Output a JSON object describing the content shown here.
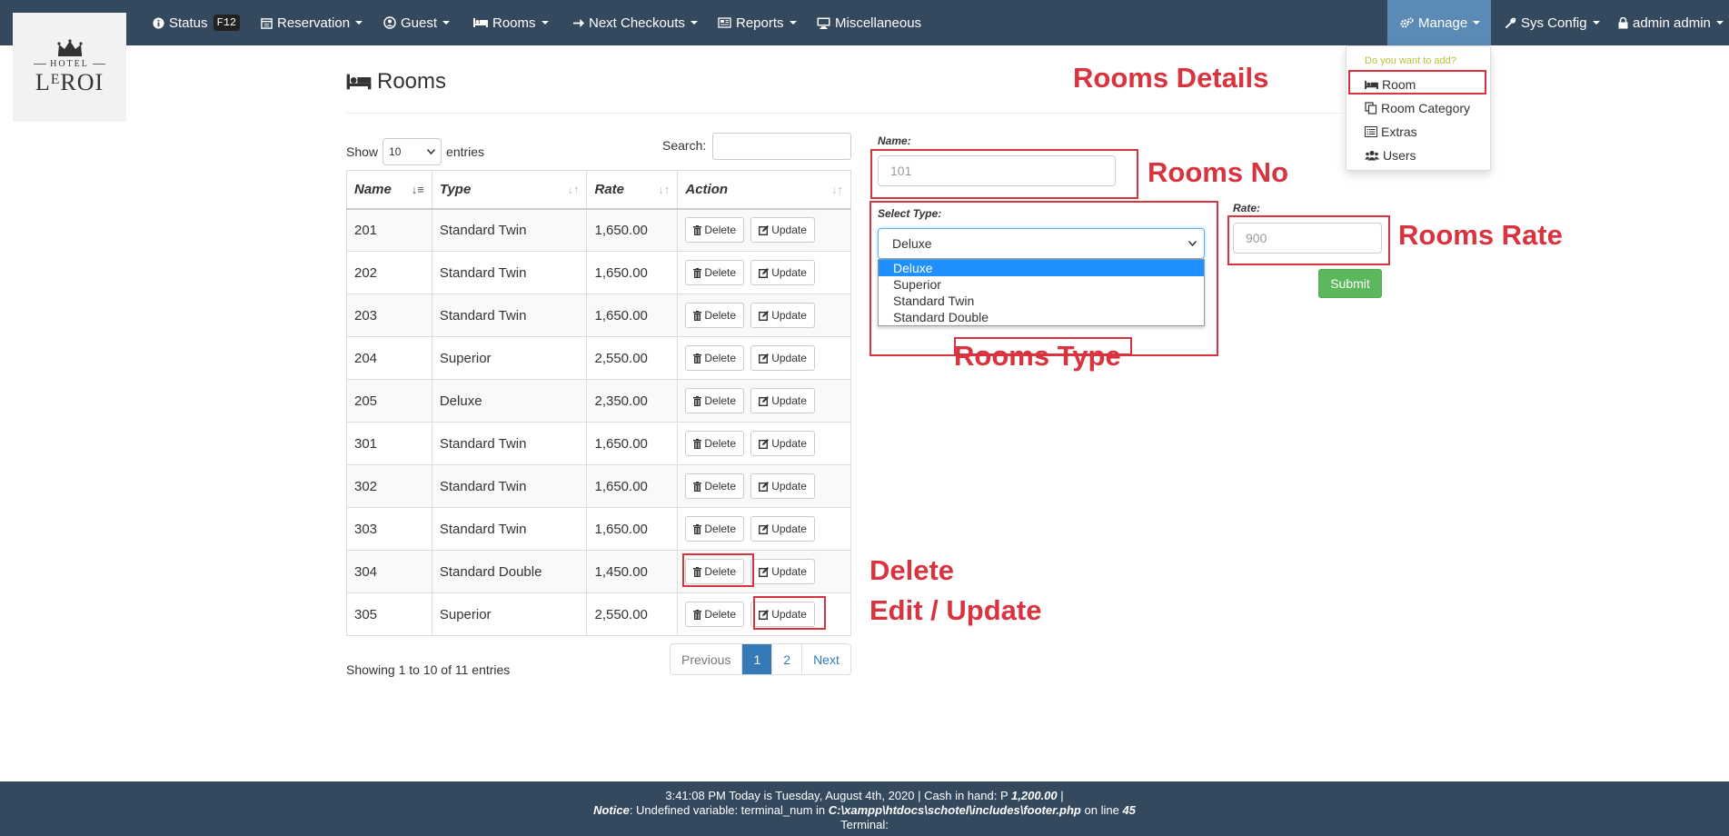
{
  "logo": {
    "top": "HOTEL",
    "name": "LᴱROI"
  },
  "navbar": {
    "status": "Status",
    "status_key": "F12",
    "reservation": "Reservation",
    "guest": "Guest",
    "rooms": "Rooms",
    "next_checkouts": "Next Checkouts",
    "reports": "Reports",
    "misc": "Miscellaneous",
    "manage": "Manage",
    "sys_config": "Sys Config",
    "user": "admin admin"
  },
  "manage_menu": {
    "header": "Do you want to add?",
    "items": [
      "Room",
      "Room Category",
      "Extras",
      "Users"
    ]
  },
  "page": {
    "title": "Rooms"
  },
  "table_controls": {
    "show_label": "Show",
    "show_value": "10",
    "entries_label": "entries",
    "search_label": "Search:"
  },
  "table": {
    "headers": [
      "Name",
      "Type",
      "Rate",
      "Action"
    ],
    "delete_label": "Delete",
    "update_label": "Update",
    "rows": [
      {
        "name": "201",
        "type": "Standard Twin",
        "rate": "1,650.00"
      },
      {
        "name": "202",
        "type": "Standard Twin",
        "rate": "1,650.00"
      },
      {
        "name": "203",
        "type": "Standard Twin",
        "rate": "1,650.00"
      },
      {
        "name": "204",
        "type": "Superior",
        "rate": "2,550.00"
      },
      {
        "name": "205",
        "type": "Deluxe",
        "rate": "2,350.00"
      },
      {
        "name": "301",
        "type": "Standard Twin",
        "rate": "1,650.00"
      },
      {
        "name": "302",
        "type": "Standard Twin",
        "rate": "1,650.00"
      },
      {
        "name": "303",
        "type": "Standard Twin",
        "rate": "1,650.00"
      },
      {
        "name": "304",
        "type": "Standard Double",
        "rate": "1,450.00"
      },
      {
        "name": "305",
        "type": "Superior",
        "rate": "2,550.00"
      }
    ],
    "info": "Showing 1 to 10 of 11 entries",
    "pager": {
      "previous": "Previous",
      "page1": "1",
      "page2": "2",
      "next": "Next"
    }
  },
  "form": {
    "name_label": "Name:",
    "name_placeholder": "101",
    "type_label": "Select Type:",
    "type_value": "Deluxe",
    "type_options": [
      "Deluxe",
      "Superior",
      "Standard Twin",
      "Standard Double"
    ],
    "rate_label": "Rate:",
    "rate_placeholder": "900",
    "submit_label": "Submit"
  },
  "annotations": {
    "rooms_details": "Rooms Details",
    "rooms_no": "Rooms No",
    "rooms_rate": "Rooms Rate",
    "rooms_type": "Rooms Type",
    "delete": "Delete",
    "edit_update": "Edit / Update"
  },
  "footer": {
    "line1": "3:41:08 PM Today is Tuesday, August 4th, 2020 | Cash in hand: P",
    "cash": "1,200.00",
    "line1_end": "|",
    "notice_label": "Notice",
    "notice_text": ": Undefined variable: terminal_num in",
    "notice_path": "C:\\xampp\\htdocs\\schotel\\includes\\footer.php",
    "notice_on": "on line",
    "notice_line": "45",
    "line3": "Terminal:"
  },
  "colors": {
    "navbar": "#34495e",
    "accent": "#337ab7",
    "annotation": "#d9333f",
    "submit": "#5cb85c"
  }
}
